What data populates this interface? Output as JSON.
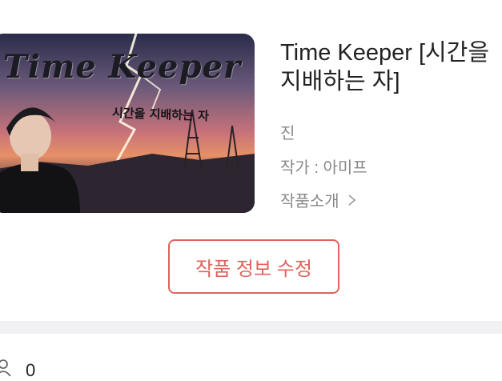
{
  "cover": {
    "title_art": "Time Keeper",
    "subtitle_art": "시간을 지배하는 자"
  },
  "work": {
    "title_line1": "Time Keeper [시간을",
    "title_line2": "지배하는 자]",
    "character": "진",
    "author": "작가 : 아미프",
    "intro_label": "작품소개"
  },
  "actions": {
    "edit_label": "작품 정보 수정"
  },
  "stats": {
    "count": "0"
  },
  "colors": {
    "accent": "#e0625c",
    "divider": "#f1f1f3",
    "meta_text": "#888888"
  },
  "icons": [
    "chevron-down-icon",
    "chevron-right-icon",
    "person-icon"
  ]
}
